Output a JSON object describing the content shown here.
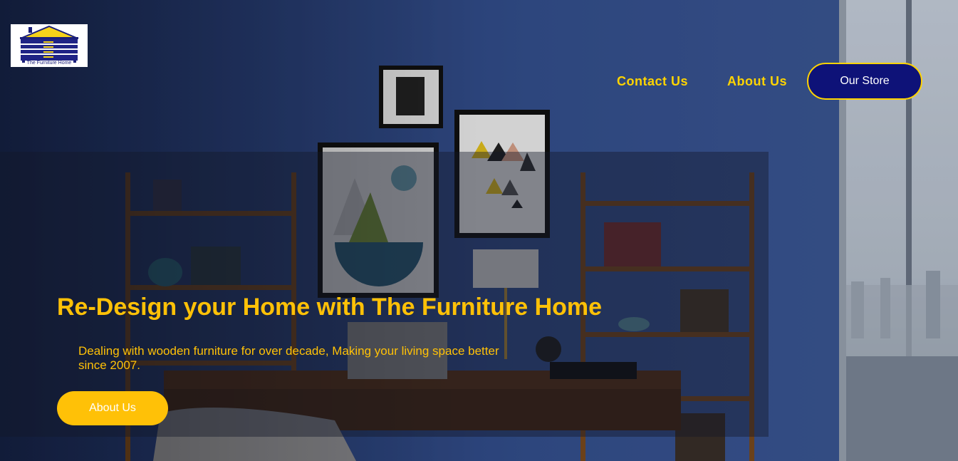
{
  "brand": {
    "name": "The Furniture Home",
    "logo_icon": "house-dresser-logo"
  },
  "nav": {
    "contact": "Contact Us",
    "about": "About Us",
    "store": "Our Store"
  },
  "hero": {
    "title": "Re-Design your Home with The Furniture Home",
    "subtitle": "Dealing with wooden furniture for over decade, Making your living space better since 2007.",
    "cta": "About Us"
  },
  "colors": {
    "accent": "#ffc107",
    "nav_text": "#ffd400",
    "store_button_bg": "#0e1278",
    "wall": "#2f4580"
  }
}
